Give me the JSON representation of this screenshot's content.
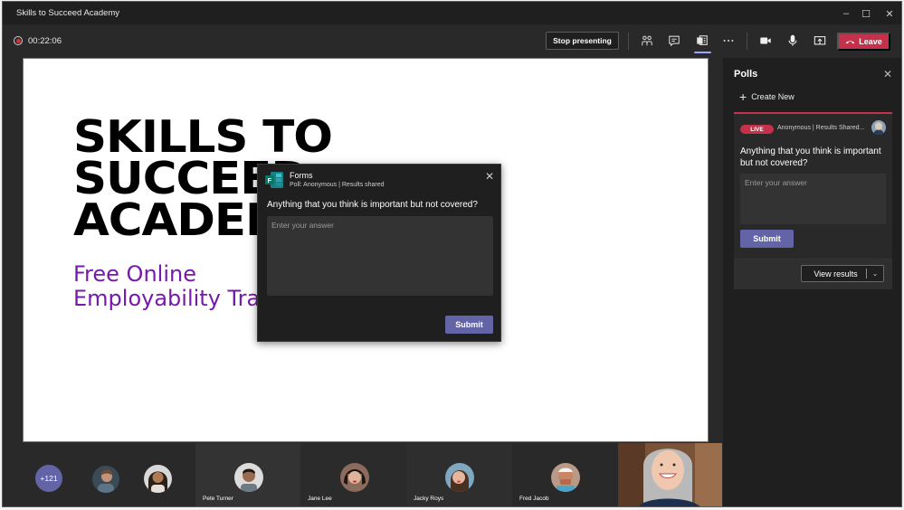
{
  "window": {
    "title": "Skills to Succeed Academy",
    "controls": {
      "minimize": "–",
      "maximize": "☐",
      "close": "✕"
    }
  },
  "toolbar": {
    "recording_time": "00:22:06",
    "stop_presenting_label": "Stop presenting",
    "leave_label": "Leave",
    "icons": [
      "people-icon",
      "chat-icon",
      "apps-icon",
      "more-icon",
      "camera-icon",
      "mic-icon",
      "share-icon"
    ],
    "active_icon": "apps-icon",
    "colors": {
      "leave": "#c4314b",
      "active_indicator": "#9ea2ff",
      "recording": "#d13438"
    }
  },
  "slide": {
    "title_lines": [
      "SKILLS TO",
      "SUCCEED",
      "ACADEMY"
    ],
    "subtitle_lines": [
      "Free Online",
      "Employability Training"
    ],
    "subtitle_color": "#7719aa"
  },
  "poll_dialog": {
    "app_name": "Forms",
    "meta": "Poll: Anonymous | Results shared",
    "question": "Anything that you think is important but not covered?",
    "answer_placeholder": "Enter your answer",
    "answer_value": "",
    "submit_label": "Submit",
    "close_icon": "✕"
  },
  "polls_panel": {
    "title": "Polls",
    "close_icon": "✕",
    "create_new_label": "Create New",
    "card": {
      "status_badge": "LIVE",
      "meta": "Anonymous | Results Shared...",
      "question": "Anything that you think is important but not covered?",
      "answer_placeholder": "Enter your answer",
      "answer_value": "",
      "submit_label": "Submit",
      "view_results_label": "View results"
    },
    "colors": {
      "accent": "#6264a7",
      "live": "#c4314b"
    }
  },
  "participants": {
    "overflow_count": "+121",
    "tiles": [
      {
        "name": "Pete Turner"
      },
      {
        "name": "Jane Lee"
      },
      {
        "name": "Jacky Roys"
      },
      {
        "name": "Fred Jacob"
      }
    ]
  }
}
